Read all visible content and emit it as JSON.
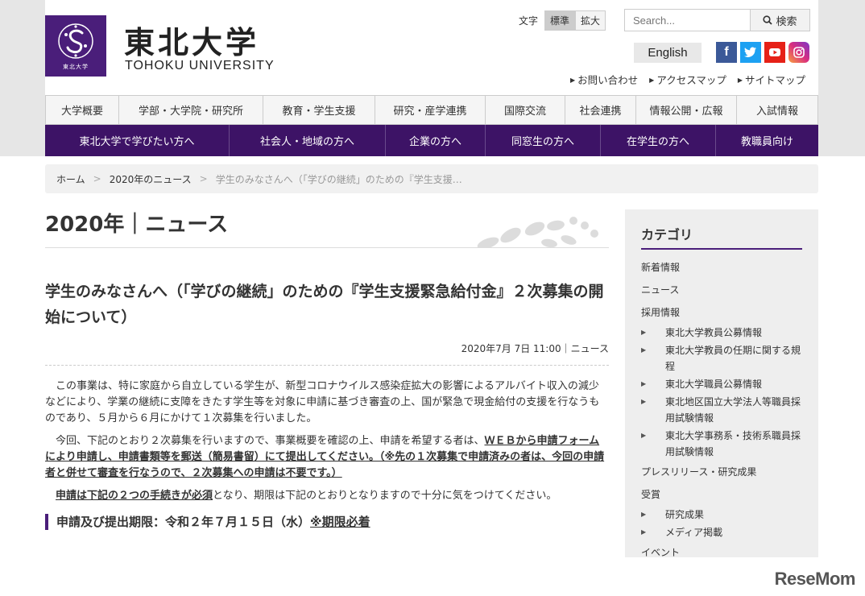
{
  "header": {
    "logo_small": "東北大学",
    "title_ja": "東北大学",
    "title_en": "TOHOKU UNIVERSITY",
    "fontsize": {
      "label": "文字",
      "standard": "標準",
      "large": "拡大"
    },
    "search": {
      "placeholder": "Search...",
      "button": "検索"
    },
    "english": "English",
    "toplinks": [
      "お問い合わせ",
      "アクセスマップ",
      "サイトマップ"
    ]
  },
  "gnav": [
    "大学概要",
    "学部・大学院・研究所",
    "教育・学生支援",
    "研究・産学連携",
    "国際交流",
    "社会連携",
    "情報公開・広報",
    "入試情報"
  ],
  "snav": [
    "東北大学で学びたい方へ",
    "社会人・地域の方へ",
    "企業の方へ",
    "同窓生の方へ",
    "在学生の方へ",
    "教職員向け"
  ],
  "breadcrumb": [
    "ホーム",
    "2020年のニュース",
    "学生のみなさんへ（「学びの継続」のための『学生支援…"
  ],
  "main": {
    "section_title": "2020年｜ニュース",
    "article_title": "学生のみなさんへ（「学びの継続」のための『学生支援緊急給付金』２次募集の開始について）",
    "meta": "2020年7月 7日 11:00｜ニュース",
    "p1": "この事業は、特に家庭から自立している学生が、新型コロナウイルス感染症拡大の影響によるアルバイト収入の減少などにより、学業の継続に支障をきたす学生等を対象に申請に基づき審査の上、国が緊急で現金給付の支援を行なうものであり、５月から６月にかけて１次募集を行いました。",
    "p2a": "今回、下記のとおり２次募集を行いますので、事業概要を確認の上、申請を希望する者は、",
    "p2b": "ＷＥＢから申請フォームにより申請し、申請書類等を郵送（簡易書留）にて提出してください。（※先の１次募集で申請済みの者は、今回の申請者と併せて審査を行なうので、２次募集への申請は不要です。）",
    "p3a": "申請は下記の２つの手続きが必須",
    "p3b": "となり、期限は下記のとおりとなりますので十分に気をつけてください。",
    "deadline_a": "申請及び提出期限：令和２年７月１５日（水）",
    "deadline_b": "※期限必着"
  },
  "sidebar": {
    "title": "カテゴリ",
    "items": [
      {
        "label": "新着情報",
        "sub": false
      },
      {
        "label": "ニュース",
        "sub": false
      },
      {
        "label": "採用情報",
        "sub": false
      },
      {
        "label": "東北大学教員公募情報",
        "sub": true
      },
      {
        "label": "東北大学教員の任期に関する規程",
        "sub": true
      },
      {
        "label": "東北大学職員公募情報",
        "sub": true
      },
      {
        "label": "東北地区国立大学法人等職員採用試験情報",
        "sub": true
      },
      {
        "label": "東北大学事務系・技術系職員採用試験情報",
        "sub": true
      },
      {
        "label": "プレスリリース・研究成果",
        "sub": false
      },
      {
        "label": "受賞",
        "sub": false
      },
      {
        "label": "研究成果",
        "sub": true
      },
      {
        "label": "メディア掲載",
        "sub": true
      },
      {
        "label": "イベント",
        "sub": false
      }
    ]
  },
  "watermark": "ReseMom",
  "colors": {
    "brand": "#4a1e7a",
    "subnav": "#3d1366"
  }
}
